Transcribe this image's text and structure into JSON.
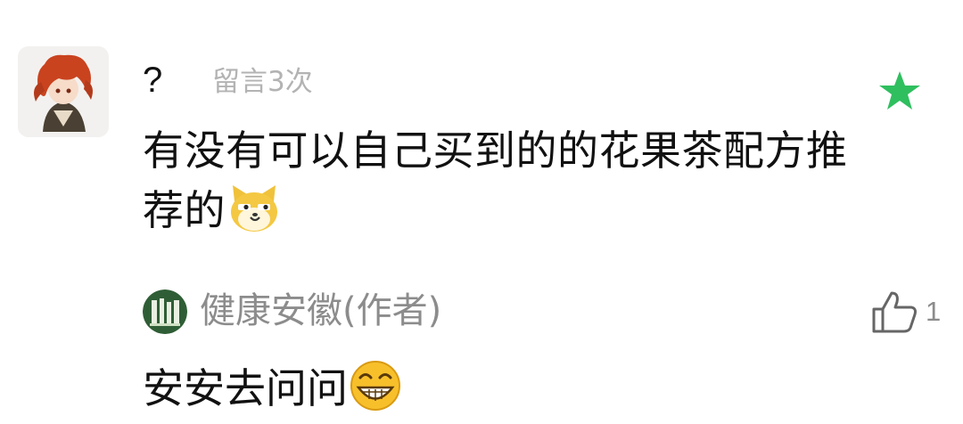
{
  "comment": {
    "username": "?",
    "message_count": "留言3次",
    "text": "有没有可以自己买到的的花果茶配方推荐的",
    "text_line1": "有没有可以自己买到的的花果茶配方推",
    "text_line2": "荐的",
    "emoji": "smirk-dog-emoji",
    "star_color": "#2fbf5f"
  },
  "reply": {
    "author": "健康安徽(作者)",
    "likes": "1",
    "text": "安安去问问",
    "emoji": "grin-emoji"
  }
}
